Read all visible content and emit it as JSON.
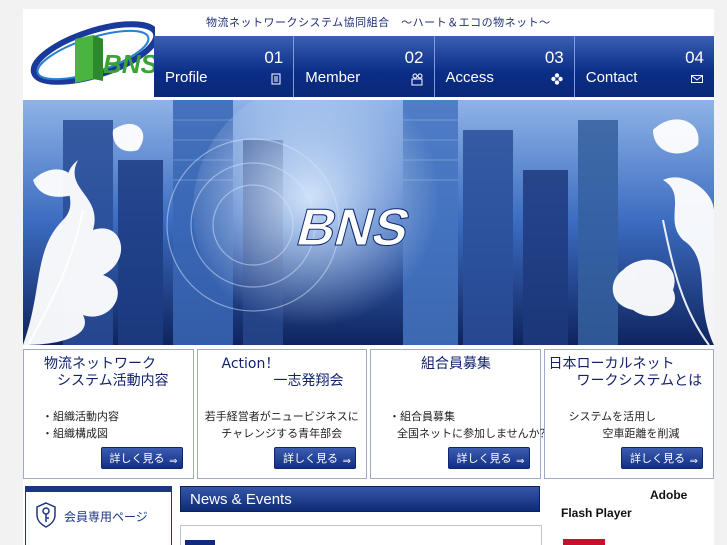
{
  "header": {
    "tagline": "物流ネットワークシステム協同組合　～ハート＆エコの物ネット～",
    "logo_text": "BNS"
  },
  "nav": [
    {
      "num": "01",
      "label": "Profile",
      "icon": "document-icon"
    },
    {
      "num": "02",
      "label": "Member",
      "icon": "people-icon"
    },
    {
      "num": "03",
      "label": "Access",
      "icon": "flower-icon"
    },
    {
      "num": "04",
      "label": "Contact",
      "icon": "envelope-icon"
    }
  ],
  "hero": {
    "logo_text": "BNS"
  },
  "boxes": [
    {
      "title_line1": "物流ネットワーク",
      "title_line2": "システム活動内容",
      "body": [
        "・組織活動内容",
        "・組織構成図"
      ],
      "more": "詳しく見る"
    },
    {
      "title_line1": "Action！",
      "title_line2": "一志発翔会",
      "body": [
        "若手経営者がニュービジネスに",
        "チャレンジする青年部会"
      ],
      "more": "詳しく見る"
    },
    {
      "title_line1": "組合員募集",
      "title_line2": "",
      "body": [
        "・組合員募集",
        "全国ネットに参加しませんか？"
      ],
      "more": "詳しく見る"
    },
    {
      "title_line1": "日本ローカルネット",
      "title_line2": "ワークシステムとは",
      "body": [
        "システムを活用し",
        "空車距離を削減"
      ],
      "more": "詳しく見る"
    }
  ],
  "members": {
    "label": "会員専用ページ"
  },
  "news": {
    "title": "News & Events"
  },
  "flash": {
    "line1": "Adobe",
    "line2": "Flash Player"
  },
  "colors": {
    "navy": "#0b2d86",
    "accent": "#1d2f7a",
    "logo_green": "#3aa335"
  }
}
